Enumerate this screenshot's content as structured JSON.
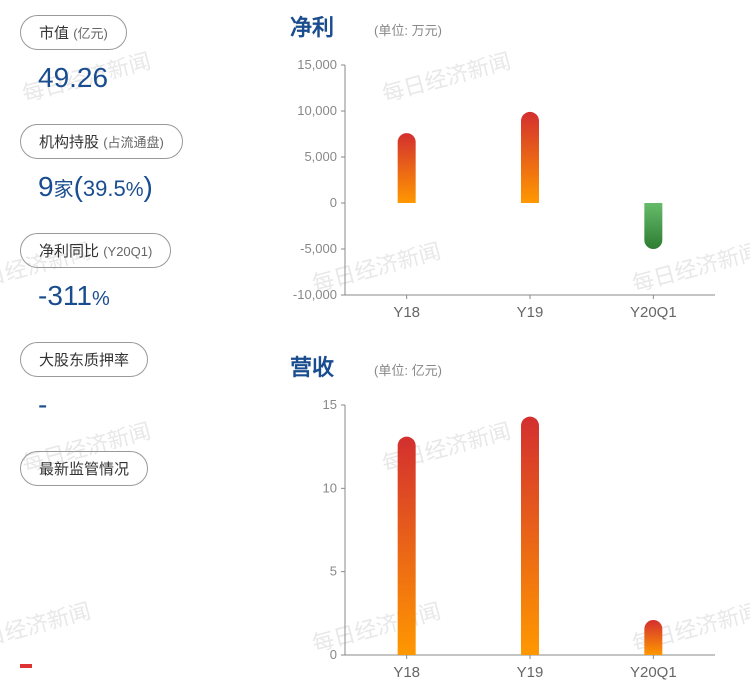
{
  "watermark_text": "每日经济新闻",
  "left": {
    "market_cap": {
      "label": "市值",
      "sub": "(亿元)",
      "value": "49.26"
    },
    "institutions": {
      "label": "机构持股",
      "sub": "(占流通盘)",
      "count": "9",
      "count_unit": "家",
      "pct": "39.5",
      "pct_unit": "%"
    },
    "profit_yoy": {
      "label": "净利同比",
      "sub": "(Y20Q1)",
      "value": "-311",
      "unit": "%"
    },
    "pledge": {
      "label": "大股东质押率",
      "value": "-"
    },
    "regulation": {
      "label": "最新监管情况"
    }
  },
  "charts": {
    "net_profit": {
      "title": "净利",
      "unit": "(单位: 万元)"
    },
    "revenue": {
      "title": "营收",
      "unit": "(单位: 亿元)"
    }
  },
  "chart_data": [
    {
      "type": "bar",
      "title": "净利",
      "unit": "万元",
      "categories": [
        "Y18",
        "Y19",
        "Y20Q1"
      ],
      "values": [
        7600,
        9900,
        -5000
      ],
      "ylim": [
        -10000,
        15000
      ],
      "yticks": [
        -10000,
        -5000,
        0,
        5000,
        10000,
        15000
      ]
    },
    {
      "type": "bar",
      "title": "营收",
      "unit": "亿元",
      "categories": [
        "Y18",
        "Y19",
        "Y20Q1"
      ],
      "values": [
        13.1,
        14.3,
        2.1
      ],
      "ylim": [
        0,
        15
      ],
      "yticks": [
        0,
        5,
        10,
        15
      ]
    }
  ]
}
